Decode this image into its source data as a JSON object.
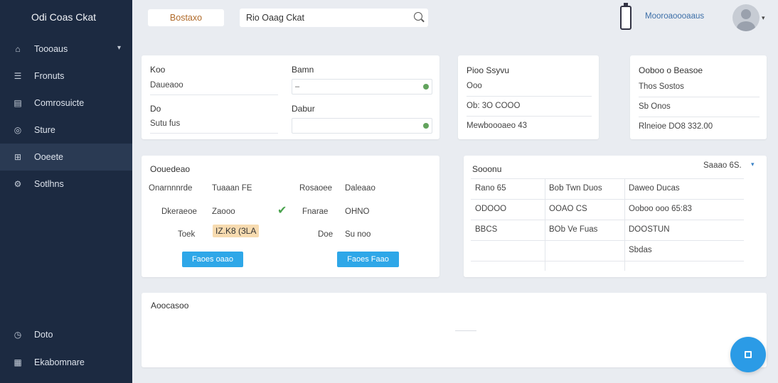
{
  "app": {
    "title": "Odi Coas Ckat"
  },
  "sidebar": {
    "items": [
      {
        "label": "Toooaus",
        "icon": "home-icon",
        "has_chevron": true
      },
      {
        "label": "Fronuts",
        "icon": "list-icon"
      },
      {
        "label": "Comrosuicte",
        "icon": "calendar-icon"
      },
      {
        "label": "Sture",
        "icon": "globe-icon"
      },
      {
        "label": "Ooeete",
        "icon": "grid-icon",
        "active": true
      },
      {
        "label": "Sotlhns",
        "icon": "gear-icon"
      }
    ],
    "bottom": [
      {
        "label": "Doto",
        "icon": "clock-icon"
      },
      {
        "label": "Ekabomnare",
        "icon": "apps-icon"
      }
    ]
  },
  "header": {
    "tag_label": "Bostaxo",
    "search_value": "Rio Oaag Ckat",
    "user_name": "Mooroaoooaaus"
  },
  "card_form": {
    "label_1": "Koo",
    "value_1": "Daueaoo",
    "label_2": "Bamn",
    "input_2": "–",
    "label_3": "Do",
    "value_3": "Sutu fus",
    "label_4": "Dabur",
    "input_4": ""
  },
  "card_summary": {
    "title": "Pioo Ssyvu",
    "value_1": "Ooo",
    "value_2": "Ob: 3O COOO",
    "value_3": "Mewboooaeo 43"
  },
  "card_detail": {
    "title": "Ooboo o Beasoe",
    "row_1": "Thos Sostos",
    "row_2": "Sb Onos",
    "row_3": "Rlneioe DO8 332.00"
  },
  "card_compare": {
    "title": "Oouedeao",
    "rows": [
      {
        "left_label": "Onarnnnrde",
        "left_value": "Tuaaan FE",
        "right_label": "Rosaoee",
        "right_value": "Daleaao"
      },
      {
        "left_label": "Dkeraeoe",
        "left_value": "Zaooo",
        "right_label": "Fnarae",
        "right_value": "OHNO"
      },
      {
        "left_label": "Toek",
        "left_value": "IZ.K8 (3LA",
        "right_label": "Doe",
        "right_value": "Su noo"
      }
    ],
    "button_left": "Faoes oaao",
    "button_right": "Faoes Faao"
  },
  "card_table": {
    "title": "Sooonu",
    "dropdown": "Saaao 6S.",
    "rows": [
      [
        "Rano 65",
        "Bob Twn Duos",
        "Daweo Ducas"
      ],
      [
        "ODOOO",
        "OOAO CS",
        "Ooboo ooo 65:83"
      ],
      [
        "BBCS",
        "BOb Ve Fuas",
        "DOOSTUN"
      ],
      [
        "",
        "",
        "Sbdas"
      ]
    ]
  },
  "card_bottom": {
    "title": "Aoocasoo"
  },
  "colors": {
    "sidebar_bg": "#1c2a41",
    "accent": "#2ea7e8",
    "green": "#3ea648",
    "orange": "#c98a20",
    "link": "#3b82c6"
  }
}
